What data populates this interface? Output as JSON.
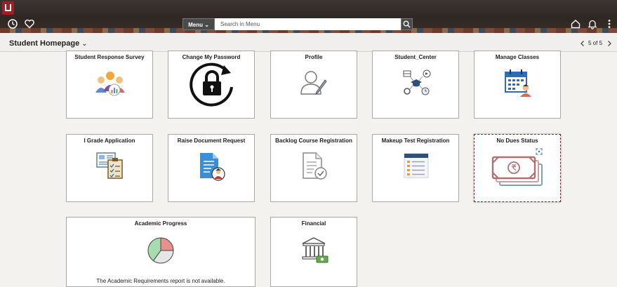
{
  "topbar": {
    "menu_label": "Menu",
    "search_placeholder": "Search in Menu",
    "icons": [
      "recent-places-icon",
      "favorites-icon",
      "home-icon",
      "notifications-icon",
      "actions-menu-icon",
      "search-icon"
    ]
  },
  "header": {
    "title": "Student Homepage",
    "page_counter": "5 of 5"
  },
  "tiles": [
    {
      "title": "Student Response Survey"
    },
    {
      "title": "Change My Password"
    },
    {
      "title": "Profile"
    },
    {
      "title": "Student_Center"
    },
    {
      "title": "Manage Classes"
    },
    {
      "title": "I Grade Application"
    },
    {
      "title": "Raise Document Request"
    },
    {
      "title": "Backlog Course Registration"
    },
    {
      "title": "Makeup Test Registration"
    },
    {
      "title": "No Dues Status"
    },
    {
      "title": "Academic Progress",
      "note": "The Academic Requirements report is not available."
    },
    {
      "title": "Financial"
    }
  ],
  "academic_progress_chart": {
    "type": "pie",
    "slices": [
      {
        "value": 25,
        "color": "#e88f8f"
      },
      {
        "value": 35,
        "color": "#e6e6e6"
      },
      {
        "value": 40,
        "color": "#a6dcae"
      }
    ]
  },
  "colors": {
    "accent": "#a01f24",
    "selected_border": "#8a1c1c"
  }
}
